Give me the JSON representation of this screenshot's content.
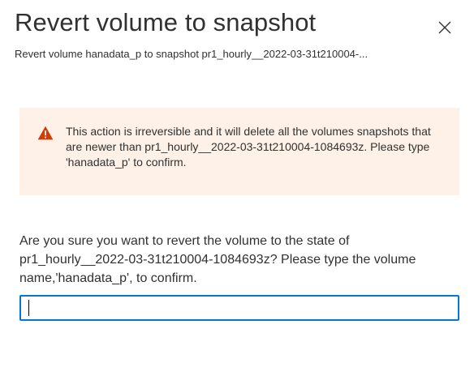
{
  "dialog": {
    "title": "Revert volume to snapshot",
    "subtitle": "Revert volume hanadata_p to snapshot pr1_hourly__2022-03-31t210004-...",
    "close_icon": "close-icon"
  },
  "warning": {
    "icon": "warning-icon",
    "icon_color": "#d83b01",
    "background_color": "#fdf1e8",
    "text": "This action is irreversible and it will delete all the volumes snapshots that are newer than pr1_hourly__2022-03-31t210004-1084693z. Please type 'hanadata_p' to confirm."
  },
  "confirmation": {
    "prompt": "Are you sure you want to revert the volume to the state of pr1_hourly__2022-03-31t210004-1084693z? Please type the volume name,'hanadata_p', to confirm.",
    "input_value": "",
    "input_border_color": "#0078d4"
  }
}
